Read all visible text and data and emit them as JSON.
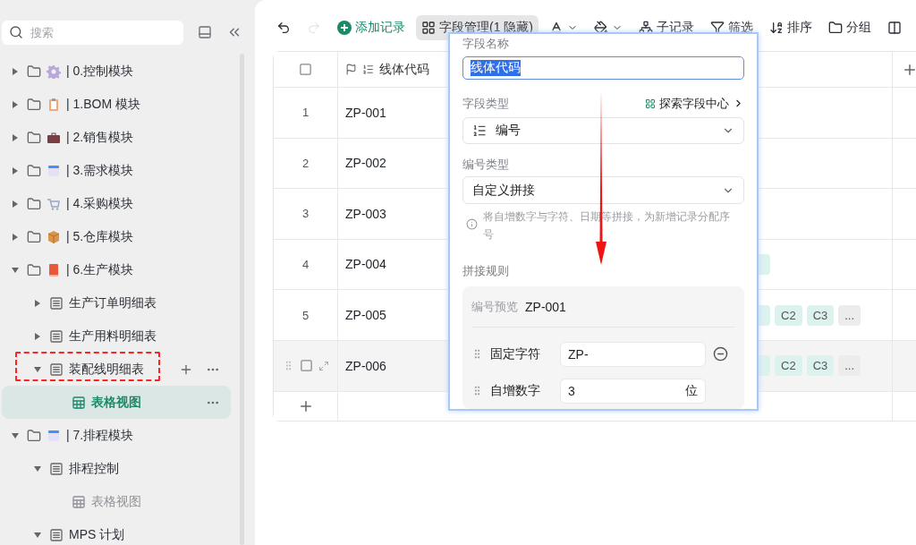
{
  "sidebar": {
    "search": {
      "placeholder": "搜索"
    },
    "tree": [
      {
        "kind": "module",
        "label": "| 0.控制模块",
        "expanded": false
      },
      {
        "kind": "module",
        "label": "| 1.BOM 模块",
        "expanded": false
      },
      {
        "kind": "module",
        "label": "| 2.销售模块",
        "expanded": false
      },
      {
        "kind": "module",
        "label": "| 3.需求模块",
        "expanded": false
      },
      {
        "kind": "module",
        "label": "| 4.采购模块",
        "expanded": false
      },
      {
        "kind": "module",
        "label": "| 5.仓库模块",
        "expanded": false
      },
      {
        "kind": "module",
        "label": "| 6.生产模块",
        "expanded": true,
        "children": [
          {
            "kind": "table",
            "label": "生产订单明细表",
            "expanded": false
          },
          {
            "kind": "table",
            "label": "生产用料明细表",
            "expanded": false
          },
          {
            "kind": "table",
            "label": "装配线明细表",
            "expanded": true,
            "hovered": true,
            "highlighted": true,
            "children": [
              {
                "kind": "view",
                "label": "表格视图",
                "selected": true
              }
            ]
          }
        ]
      },
      {
        "kind": "module",
        "label": "| 7.排程模块",
        "expanded": true,
        "children": [
          {
            "kind": "table",
            "label": "排程控制",
            "expanded": true,
            "children": [
              {
                "kind": "view",
                "label": "表格视图",
                "selected": false
              }
            ]
          },
          {
            "kind": "table",
            "label": "MPS 计划",
            "expanded": true
          }
        ]
      }
    ]
  },
  "toolbar": [
    {
      "kind": "undo",
      "disabled": false,
      "active": false
    },
    {
      "kind": "redo",
      "disabled": true,
      "active": false
    },
    {
      "kind": "add",
      "label": "添加记录",
      "disabled": false,
      "active": false
    },
    {
      "kind": "fields",
      "label": "字段管理(1 隐藏)",
      "disabled": false,
      "active": true
    },
    {
      "kind": "text-color",
      "disabled": false,
      "active": false
    },
    {
      "kind": "fill-color",
      "disabled": false,
      "active": false
    },
    {
      "kind": "subrecord",
      "label": "子记录",
      "disabled": false,
      "active": false
    },
    {
      "kind": "filter",
      "label": "筛选",
      "disabled": false,
      "active": false
    },
    {
      "kind": "sort",
      "label": "排序",
      "disabled": false,
      "active": false
    },
    {
      "kind": "group",
      "label": "分组",
      "disabled": false,
      "active": false
    },
    {
      "kind": "columns",
      "disabled": false,
      "active": false
    }
  ],
  "table": {
    "header_checked": false,
    "columns": [
      {
        "label": "线体代码"
      }
    ],
    "rows": [
      {
        "number": "1",
        "code": "ZP-001",
        "hovered": false,
        "partial_tag": false
      },
      {
        "number": "2",
        "code": "ZP-002",
        "hovered": false,
        "partial_tag": false
      },
      {
        "number": "3",
        "code": "ZP-003",
        "hovered": false,
        "partial_tag": false
      },
      {
        "number": "4",
        "code": "ZP-004",
        "hovered": false,
        "partial_tag": true
      },
      {
        "number": "5",
        "code": "ZP-005",
        "hovered": false,
        "partial_tag": true,
        "tags": [
          "C2",
          "C3"
        ],
        "more": "..."
      },
      {
        "code": "ZP-006",
        "hovered": true,
        "partial_tag": true,
        "tags": [
          "C2",
          "C3"
        ],
        "more": "..."
      }
    ]
  },
  "field_popup": {
    "field_name": {
      "label": "字段名称",
      "value": "线体代码",
      "text_selected": true
    },
    "field_type": {
      "label": "字段类型",
      "link": "探索字段中心",
      "value": "编号"
    },
    "number_type": {
      "label": "编号类型",
      "value": "自定义拼接",
      "hint": "将自增数字与字符、日期等拼接，为新增记录分配序号"
    },
    "rules": {
      "label": "拼接规则",
      "preview_label": "编号预览",
      "preview": "ZP-001",
      "items": [
        {
          "kind": "text",
          "label": "固定字符",
          "value": "ZP-"
        },
        {
          "kind": "counter",
          "label": "自增数字",
          "value": "3",
          "unit": "位"
        }
      ]
    }
  }
}
